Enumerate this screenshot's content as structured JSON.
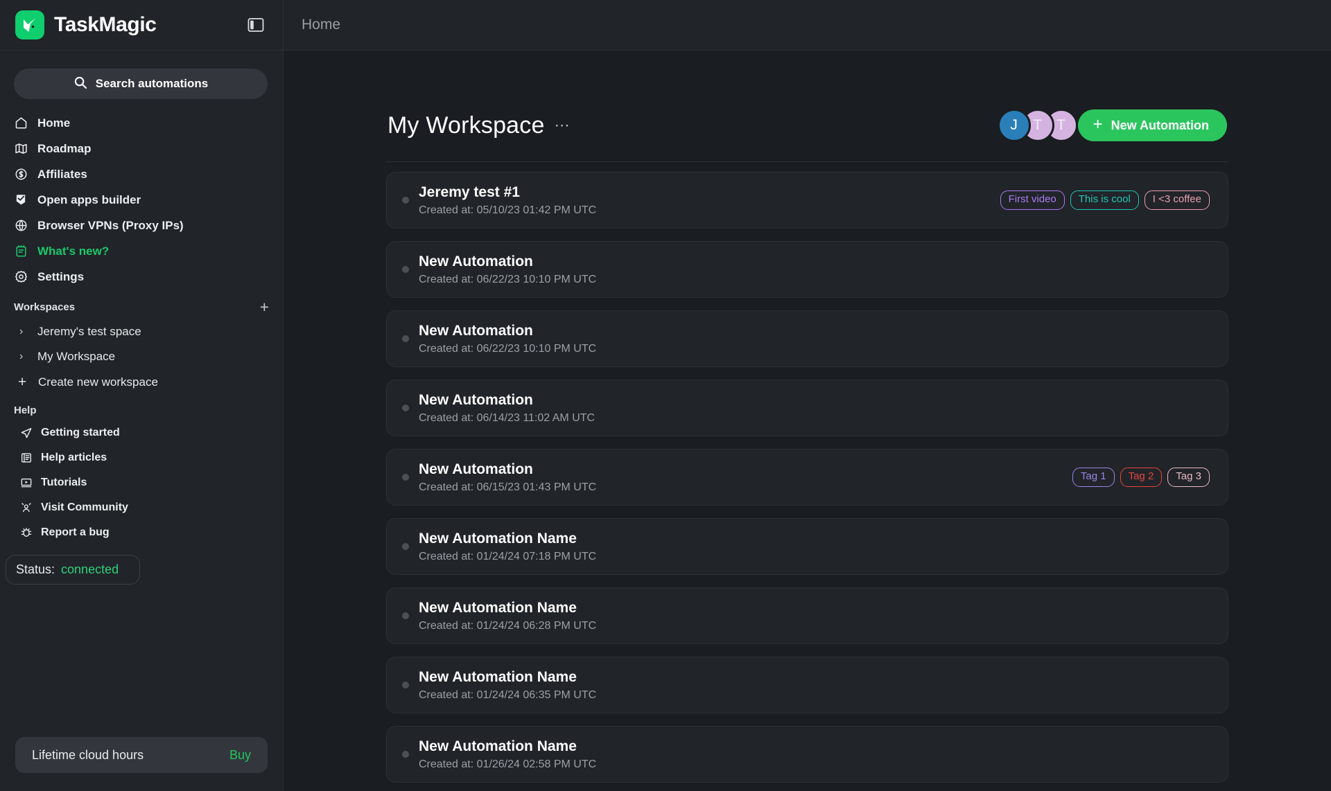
{
  "brand": {
    "name": "TaskMagic",
    "logo_icon": "green-check-logo",
    "accent": "#0ece6d"
  },
  "topbar": {
    "panel_toggle_icon": "sidebar-toggle-icon",
    "breadcrumb": "Home"
  },
  "sidebar": {
    "search": {
      "label": "Search automations",
      "icon": "search-icon"
    },
    "nav": [
      {
        "label": "Home",
        "icon": "home-icon",
        "accent": false
      },
      {
        "label": "Roadmap",
        "icon": "map-icon",
        "accent": false
      },
      {
        "label": "Affiliates",
        "icon": "dollar-circle-icon",
        "accent": false
      },
      {
        "label": "Open apps builder",
        "icon": "app-check-icon",
        "accent": false
      },
      {
        "label": "Browser VPNs (Proxy IPs)",
        "icon": "globe-icon",
        "accent": false
      },
      {
        "label": "What's new?",
        "icon": "notepad-icon",
        "accent": true
      },
      {
        "label": "Settings",
        "icon": "gear-icon",
        "accent": false
      }
    ],
    "workspaces": {
      "heading": "Workspaces",
      "add_icon": "plus-icon",
      "items": [
        {
          "label": "Jeremy's test space",
          "icon": "chevron-right-icon"
        },
        {
          "label": "My Workspace",
          "icon": "chevron-right-icon"
        }
      ],
      "create": {
        "label": "Create new workspace",
        "icon": "plus-icon"
      }
    },
    "help": {
      "heading": "Help",
      "items": [
        {
          "label": "Getting started",
          "icon": "paper-plane-icon"
        },
        {
          "label": "Help articles",
          "icon": "article-icon"
        },
        {
          "label": "Tutorials",
          "icon": "video-icon"
        },
        {
          "label": "Visit Community",
          "icon": "community-icon"
        },
        {
          "label": "Report a bug",
          "icon": "bug-icon"
        }
      ]
    },
    "status": {
      "label": "Status:",
      "value": "connected",
      "value_color": "#2fd07c"
    },
    "cloud": {
      "label": "Lifetime cloud hours",
      "action": "Buy",
      "action_color": "#22c55e"
    }
  },
  "main": {
    "workspace_title": "My Workspace",
    "workspace_menu_icon": "ellipsis-icon",
    "members": [
      {
        "initial": "J",
        "bg": "#2a7fb8",
        "fg": "#ffffff"
      },
      {
        "initial": "T",
        "bg": "#d5b3e0",
        "fg": "#f3eaf6"
      },
      {
        "initial": "T",
        "bg": "#d5b3e0",
        "fg": "#f3eaf6"
      }
    ],
    "new_automation_button": {
      "label": "New Automation",
      "icon": "plus-icon",
      "bg": "#2bc55e"
    },
    "automations": [
      {
        "title": "Jeremy test #1",
        "created": "Created at: 05/10/23 01:42 PM UTC",
        "tags": [
          {
            "label": "First video",
            "color": "#a97cf0"
          },
          {
            "label": "This is cool",
            "color": "#21c7b6"
          },
          {
            "label": "I <3 coffee",
            "color": "#e8a0ae"
          }
        ]
      },
      {
        "title": "New Automation",
        "created": "Created at: 06/22/23 10:10 PM UTC",
        "tags": []
      },
      {
        "title": "New Automation",
        "created": "Created at: 06/22/23 10:10 PM UTC",
        "tags": []
      },
      {
        "title": "New Automation",
        "created": "Created at: 06/14/23 11:02 AM UTC",
        "tags": []
      },
      {
        "title": "New Automation",
        "created": "Created at: 06/15/23 01:43 PM UTC",
        "tags": [
          {
            "label": "Tag 1",
            "color": "#9a86e8"
          },
          {
            "label": "Tag 2",
            "color": "#e8453c"
          },
          {
            "label": "Tag 3",
            "color": "#e9bcc2"
          }
        ]
      },
      {
        "title": "New Automation Name",
        "created": "Created at: 01/24/24 07:18 PM UTC",
        "tags": []
      },
      {
        "title": "New Automation Name",
        "created": "Created at: 01/24/24 06:28 PM UTC",
        "tags": []
      },
      {
        "title": "New Automation Name",
        "created": "Created at: 01/24/24 06:35 PM UTC",
        "tags": []
      },
      {
        "title": "New Automation Name",
        "created": "Created at: 01/26/24 02:58 PM UTC",
        "tags": []
      }
    ]
  }
}
